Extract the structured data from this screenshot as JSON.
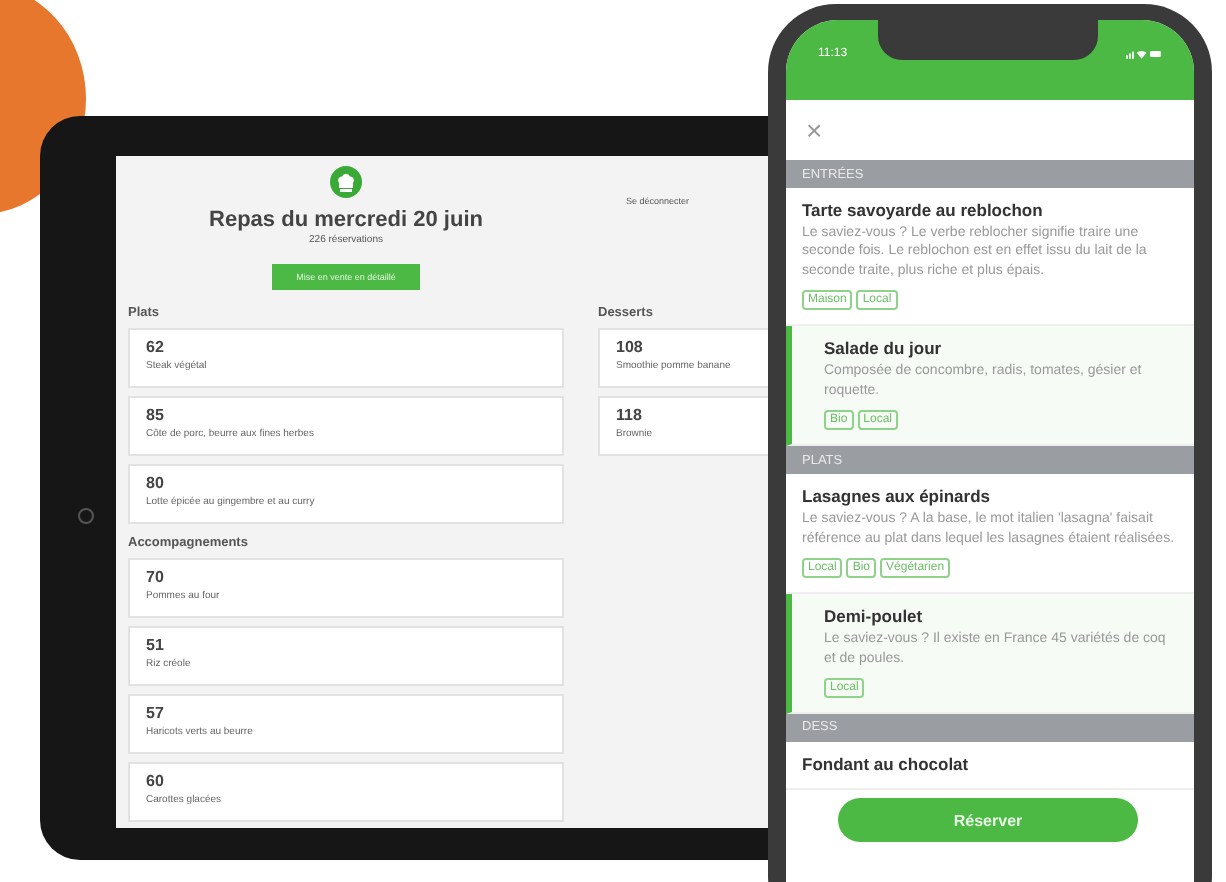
{
  "tablet": {
    "title": "Repas du mercredi 20 juin",
    "subtitle": "226 réservations",
    "logout": "Se déconnecter",
    "action_button": "Mise en vente en détaillé",
    "columns": [
      {
        "sections": [
          {
            "heading": "Plats",
            "items": [
              {
                "count": "62",
                "name": "Steak végétal"
              },
              {
                "count": "85",
                "name": "Côte de porc, beurre aux fines herbes"
              },
              {
                "count": "80",
                "name": "Lotte épicée au gingembre et au curry"
              }
            ]
          },
          {
            "heading": "Accompagnements",
            "items": [
              {
                "count": "70",
                "name": "Pommes au four"
              },
              {
                "count": "51",
                "name": "Riz créole"
              },
              {
                "count": "57",
                "name": "Haricots verts au beurre"
              },
              {
                "count": "60",
                "name": "Carottes glacées"
              }
            ]
          }
        ]
      },
      {
        "sections": [
          {
            "heading": "Desserts",
            "items": [
              {
                "count": "108",
                "name": "Smoothie pomme banane"
              },
              {
                "count": "118",
                "name": "Brownie"
              }
            ]
          }
        ]
      }
    ]
  },
  "phone": {
    "time": "11:13",
    "close": "×",
    "button": "Réserver",
    "sections": [
      {
        "title": "ENTRÉES",
        "items": [
          {
            "name": "Tarte savoyarde au reblochon",
            "description": "Le saviez-vous ? Le verbe reblocher signifie traire une seconde fois. Le reblochon est en effet issu du lait de la seconde traite, plus riche et plus épais.",
            "tags": [
              "Maison",
              "Local"
            ],
            "selected": false
          },
          {
            "name": "Salade du jour",
            "description": "Composée de concombre, radis, tomates, gésier et roquette.",
            "tags": [
              "Bio",
              "Local"
            ],
            "selected": true
          }
        ]
      },
      {
        "title": "PLATS",
        "items": [
          {
            "name": "Lasagnes aux épinards",
            "description": "Le saviez-vous ? A la base, le mot italien 'lasagna' faisait référence au plat dans lequel les lasagnes étaient réalisées.",
            "tags": [
              "Local",
              "Bio",
              "Végétarien"
            ],
            "selected": false
          },
          {
            "name": "Demi-poulet",
            "description": "Le saviez-vous ? Il existe en France 45 variétés de coq et de poules.",
            "tags": [
              "Local"
            ],
            "selected": true
          }
        ]
      },
      {
        "title": "DESS",
        "items": [
          {
            "name": "Fondant au chocolat",
            "selected": false
          }
        ]
      }
    ]
  }
}
